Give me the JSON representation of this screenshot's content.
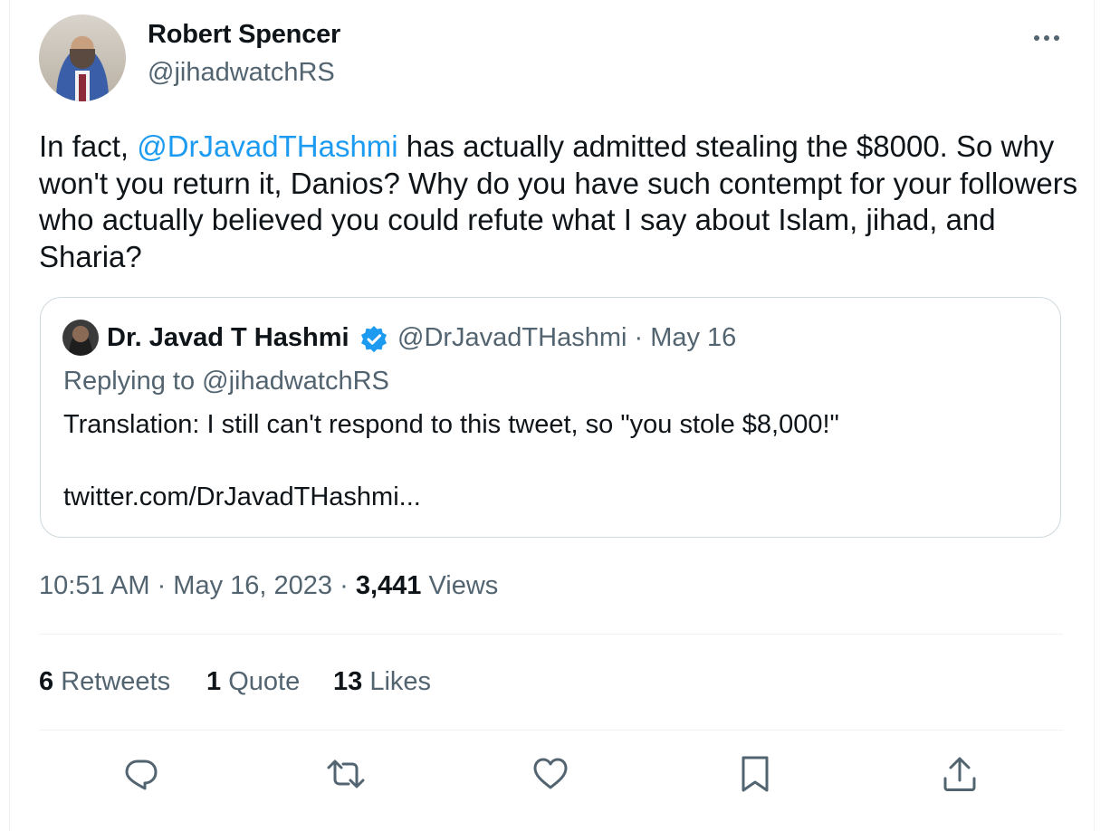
{
  "author": {
    "name": "Robert Spencer",
    "handle": "@jihadwatchRS"
  },
  "tweet": {
    "text_before": "In fact, ",
    "mention": "@DrJavadTHashmi",
    "text_after": " has actually admitted stealing the $8000. So why won't you return it, Danios? Why do you have such contempt for your followers who actually believed you could refute what I say about Islam, jihad, and Sharia?"
  },
  "quoted_tweet": {
    "name": "Dr. Javad T Hashmi",
    "handle_date": "@DrJavadTHashmi · May 16",
    "replying_to": "Replying to @jihadwatchRS",
    "text": "Translation: I still can't respond to this tweet, so \"you stole $8,000!\"",
    "link": "twitter.com/DrJavadTHashmi..."
  },
  "meta": {
    "time_date": "10:51 AM · May 16, 2023 · ",
    "views_count": "3,441",
    "views_label": " Views"
  },
  "stats": {
    "retweets_count": "6",
    "retweets_label": " Retweets",
    "quotes_count": "1",
    "quotes_label": " Quote",
    "likes_count": "13",
    "likes_label": " Likes"
  },
  "icons": {
    "more": "more-horizontal-icon",
    "verified": "verified-badge-icon",
    "reply": "reply-icon",
    "retweet": "retweet-icon",
    "like": "heart-icon",
    "bookmark": "bookmark-icon",
    "share": "share-icon"
  },
  "colors": {
    "text": "#0f1419",
    "secondary": "#536471",
    "accent": "#1d9bf0",
    "border": "#cfd9de"
  }
}
